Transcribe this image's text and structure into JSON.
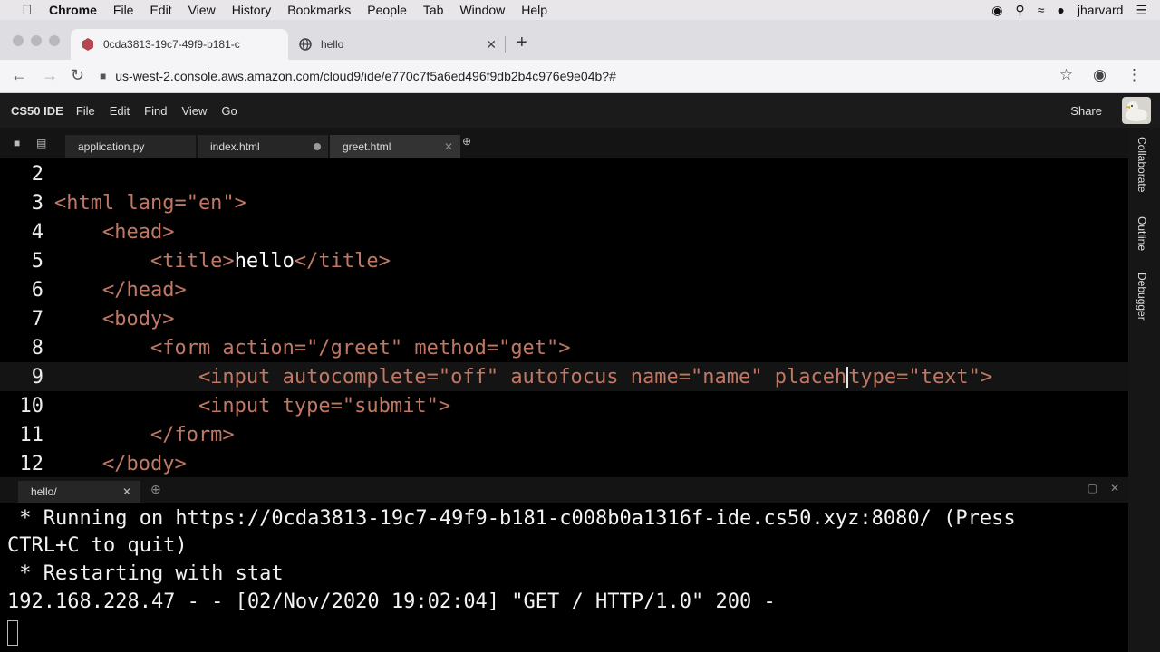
{
  "menubar": {
    "app": "Chrome",
    "items": [
      "File",
      "Edit",
      "View",
      "History",
      "Bookmarks",
      "People",
      "Tab",
      "Window",
      "Help"
    ],
    "user": "jharvard"
  },
  "browser": {
    "tabs": [
      {
        "title": "0cda3813-19c7-49f9-b181-c"
      },
      {
        "title": "hello"
      }
    ],
    "url": "us-west-2.console.aws.amazon.com/cloud9/ide/e770c7f5a6ed496f9db2b4c976e9e04b?#"
  },
  "ide": {
    "brand": "CS50 IDE",
    "menu": [
      "File",
      "Edit",
      "Find",
      "View",
      "Go"
    ],
    "share": "Share",
    "tabs": [
      "application.py",
      "index.html",
      "greet.html"
    ],
    "sidebar": [
      "Collaborate",
      "Outline",
      "Debugger"
    ]
  },
  "editor": {
    "lines": [
      {
        "num": "2",
        "code": ""
      },
      {
        "num": "3",
        "code": "<html lang=\"en\">"
      },
      {
        "num": "4",
        "code": "    <head>"
      },
      {
        "num": "5",
        "pre": "        <title>",
        "text": "hello",
        "post": "</title>"
      },
      {
        "num": "6",
        "code": "    </head>"
      },
      {
        "num": "7",
        "code": "    <body>"
      },
      {
        "num": "8",
        "code": "        <form action=\"/greet\" method=\"get\">"
      },
      {
        "num": "9",
        "pre": "            <input autocomplete=\"off\" autofocus name=\"name\" placeh",
        "post": "type=\"text\">"
      },
      {
        "num": "10",
        "code": "            <input type=\"submit\">"
      },
      {
        "num": "11",
        "code": "        </form>"
      },
      {
        "num": "12",
        "code": "    </body>"
      }
    ]
  },
  "terminal": {
    "tab": "hello/",
    "lines": [
      " * Running on https://0cda3813-19c7-49f9-b181-c008b0a1316f-ide.cs50.xyz:8080/ (Press",
      "CTRL+C to quit)",
      " * Restarting with stat",
      "192.168.228.47 - - [02/Nov/2020 19:02:04] \"GET / HTTP/1.0\" 200 -"
    ]
  }
}
